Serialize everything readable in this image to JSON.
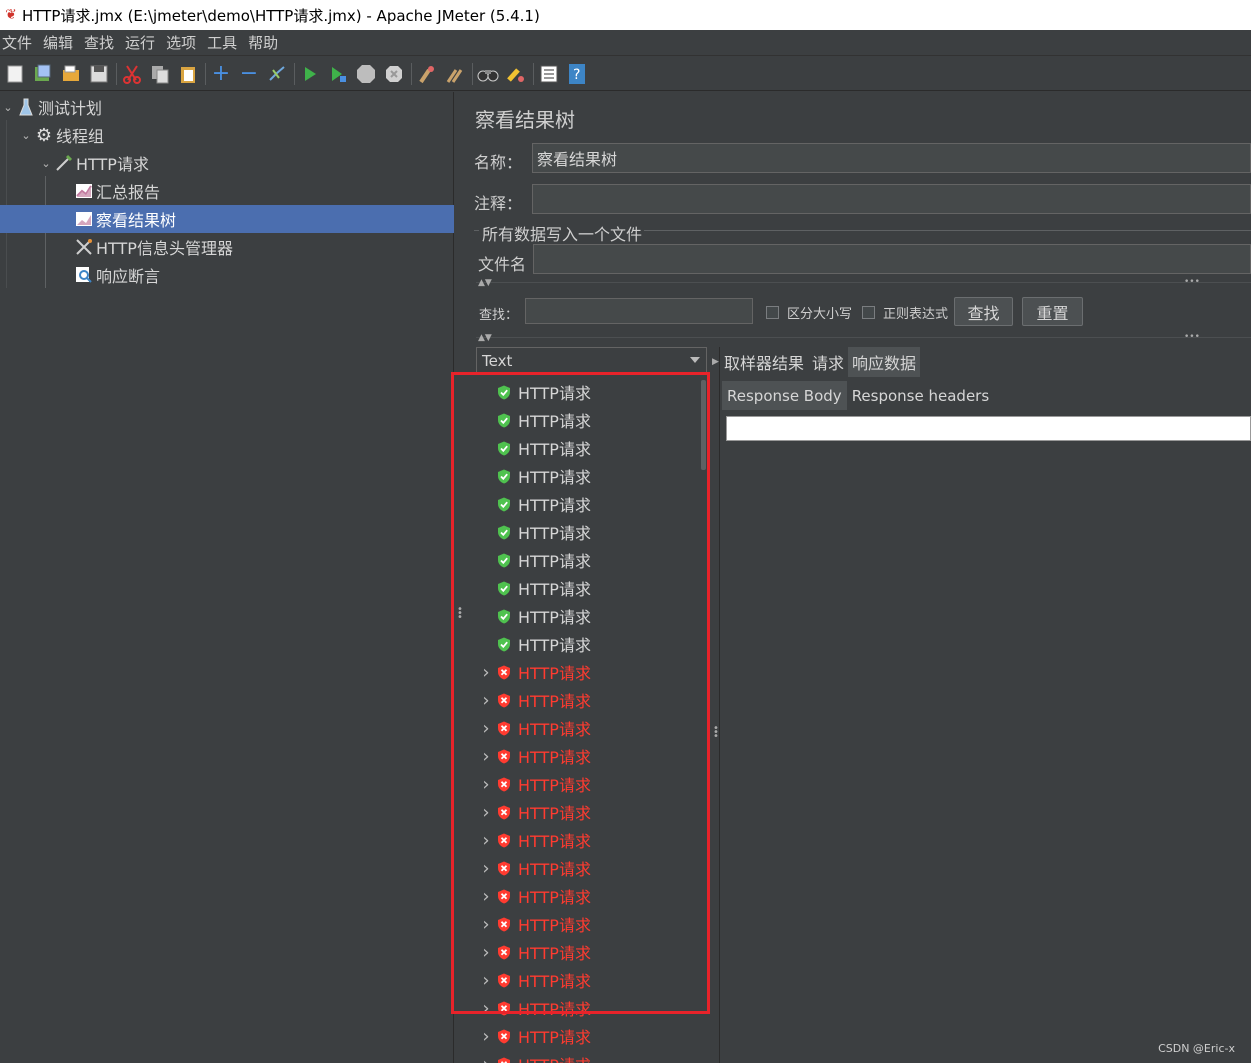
{
  "window": {
    "title": "HTTP请求.jmx (E:\\jmeter\\demo\\HTTP请求.jmx) - Apache JMeter (5.4.1)"
  },
  "menu": [
    "文件",
    "编辑",
    "查找",
    "运行",
    "选项",
    "工具",
    "帮助"
  ],
  "toolbar_icons": [
    "new-icon",
    "templates-icon",
    "open-icon",
    "save-icon",
    "cut-icon",
    "copy-icon",
    "paste-icon",
    "expand-icon",
    "collapse-icon",
    "toggle-icon",
    "start-icon",
    "start-no-pause-icon",
    "stop-icon",
    "shutdown-icon",
    "clear-icon",
    "clear-all-icon",
    "search-icon",
    "reset-search-icon",
    "function-helper-icon",
    "help-icon"
  ],
  "tree": {
    "items": [
      {
        "label": "测试计划",
        "icon": "flask-icon",
        "expanded": true
      },
      {
        "label": "线程组",
        "icon": "gear-icon",
        "expanded": true
      },
      {
        "label": "HTTP请求",
        "icon": "pipette-icon",
        "expanded": true
      },
      {
        "label": "汇总报告",
        "icon": "graph-icon"
      },
      {
        "label": "察看结果树",
        "icon": "graph-icon",
        "selected": true
      },
      {
        "label": "HTTP信息头管理器",
        "icon": "tools-icon"
      },
      {
        "label": "响应断言",
        "icon": "magnifier-icon"
      }
    ]
  },
  "panel": {
    "title": "察看结果树",
    "name_label": "名称：",
    "name_value": "察看结果树",
    "comment_label": "注释：",
    "comment_value": "",
    "file_group_title": "所有数据写入一个文件",
    "filename_label": "文件名",
    "filename_value": "",
    "search_label": "查找：",
    "search_value": "",
    "case_sensitive_label": "区分大小写",
    "regex_label": "正则表达式",
    "find_button": "查找",
    "reset_button": "重置"
  },
  "renderer": {
    "selected": "Text"
  },
  "results": [
    {
      "label": "HTTP请求",
      "status": "success"
    },
    {
      "label": "HTTP请求",
      "status": "success"
    },
    {
      "label": "HTTP请求",
      "status": "success"
    },
    {
      "label": "HTTP请求",
      "status": "success"
    },
    {
      "label": "HTTP请求",
      "status": "success"
    },
    {
      "label": "HTTP请求",
      "status": "success"
    },
    {
      "label": "HTTP请求",
      "status": "success"
    },
    {
      "label": "HTTP请求",
      "status": "success"
    },
    {
      "label": "HTTP请求",
      "status": "success"
    },
    {
      "label": "HTTP请求",
      "status": "success"
    },
    {
      "label": "HTTP请求",
      "status": "failure"
    },
    {
      "label": "HTTP请求",
      "status": "failure"
    },
    {
      "label": "HTTP请求",
      "status": "failure"
    },
    {
      "label": "HTTP请求",
      "status": "failure"
    },
    {
      "label": "HTTP请求",
      "status": "failure"
    },
    {
      "label": "HTTP请求",
      "status": "failure"
    },
    {
      "label": "HTTP请求",
      "status": "failure"
    },
    {
      "label": "HTTP请求",
      "status": "failure"
    },
    {
      "label": "HTTP请求",
      "status": "failure"
    },
    {
      "label": "HTTP请求",
      "status": "failure"
    },
    {
      "label": "HTTP请求",
      "status": "failure"
    },
    {
      "label": "HTTP请求",
      "status": "failure"
    },
    {
      "label": "HTTP请求",
      "status": "failure"
    },
    {
      "label": "HTTP请求",
      "status": "failure"
    },
    {
      "label": "HTTP请求",
      "status": "failure"
    }
  ],
  "tabs": [
    {
      "label": "取样器结果",
      "active": false
    },
    {
      "label": "请求",
      "active": false
    },
    {
      "label": "响应数据",
      "active": true
    }
  ],
  "subtabs": [
    {
      "label": "Response Body",
      "active": true
    },
    {
      "label": "Response headers",
      "active": false
    }
  ],
  "colors": {
    "success": "#4fc24f",
    "failure": "#ff3b30",
    "highlight_box": "#e8232a",
    "selection": "#4b6eaf"
  },
  "watermark": "CSDN @Eric-x"
}
